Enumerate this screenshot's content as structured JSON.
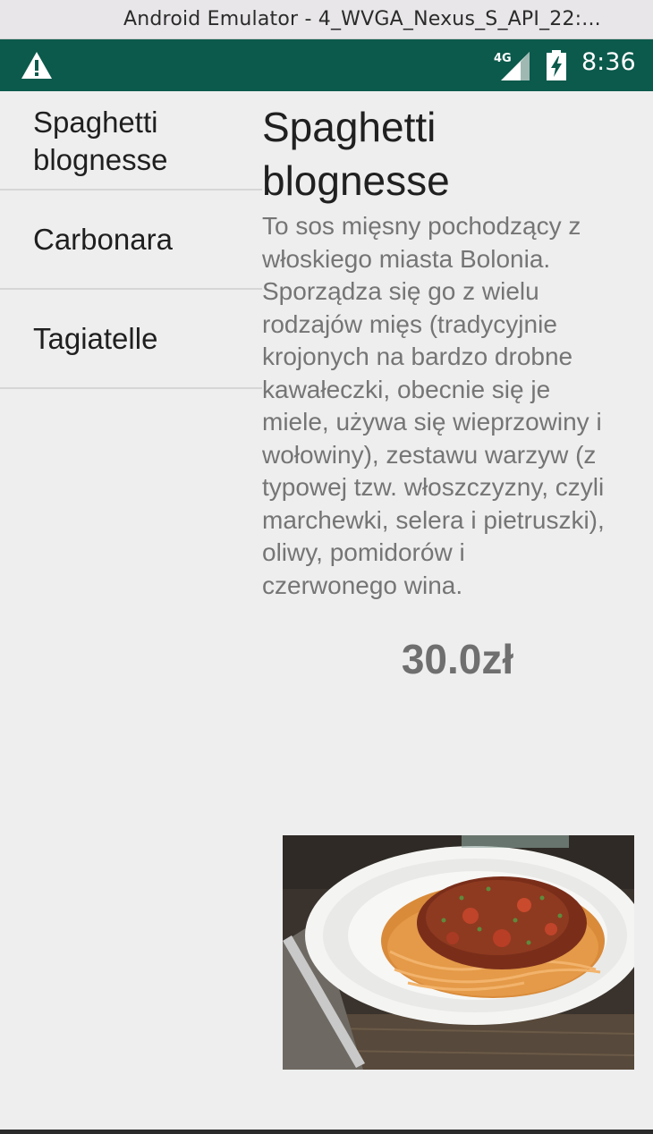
{
  "window": {
    "title": "Android Emulator - 4_WVGA_Nexus_S_API_22:..."
  },
  "status_bar": {
    "time": "8:36",
    "network": "4G",
    "bg_color": "#0b5a4c",
    "icons": [
      "warning-icon",
      "signal-4g-icon",
      "battery-charging-icon"
    ]
  },
  "recipes": [
    {
      "label": "Spaghetti\nblognesse"
    },
    {
      "label": "Carbonara"
    },
    {
      "label": "Tagiatelle"
    }
  ],
  "detail": {
    "title": "Spaghetti\nblognesse",
    "description": "To sos mięsny pochodzący z\nwłoskiego miasta Bolonia.\nSporządza się go z wielu\nrodzajów mięs (tradycyjnie\nkrojonych na bardzo drobne\nkawałeczki, obecnie się je\nmiele, używa się wieprzowiny i\nwołowiny), zestawu warzyw (z\ntypowej tzw. włoszczyzny, czyli\nmarchewki, selera i pietruszki),\noliwy, pomidorów i\nczerwonego wina.",
    "price": "30.0zł",
    "image": "spaghetti-bolognese-plate-photo"
  }
}
